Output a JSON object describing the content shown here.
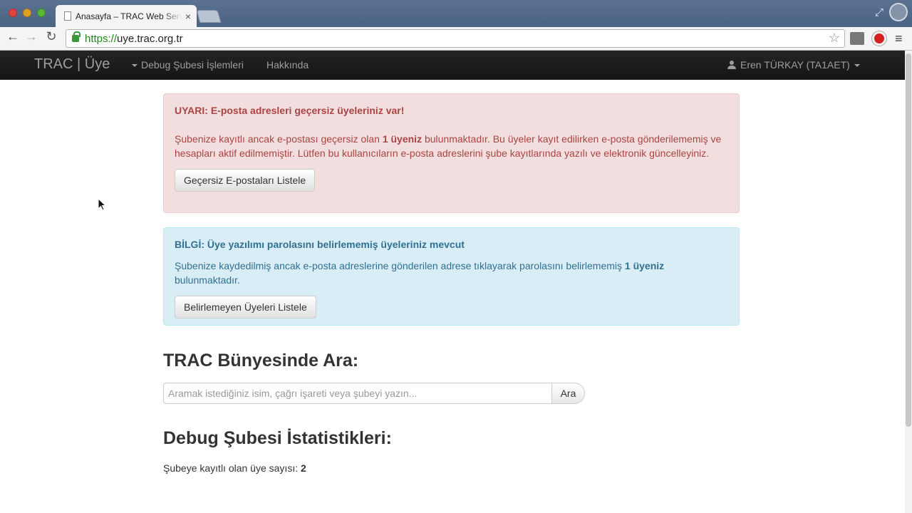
{
  "browser": {
    "tab_title": "Anasayfa – TRAC Web Servisleri",
    "tab_close": "×",
    "url_scheme": "https://",
    "url_rest": "uye.trac.org.tr",
    "icons": {
      "back": "back-arrow-icon",
      "forward": "forward-arrow-icon",
      "reload": "reload-icon",
      "bookmark": "star-icon",
      "menu": "hamburger-menu-icon"
    }
  },
  "navbar": {
    "brand": "TRAC | Üye",
    "debug_menu": "Debug Şubesi İşlemleri",
    "about": "Hakkında",
    "user": "Eren TÜRKAY (TA1AET)"
  },
  "alerts": {
    "danger": {
      "title": "UYARI: E-posta adresleri geçersiz üyeleriniz var!",
      "body_before": "Şubenize kayıtlı ancak e-postası geçersiz olan ",
      "body_bold": "1 üyeniz",
      "body_after": " bulunmaktadır. Bu üyeler kayıt edilirken e-posta gönderilememiş ve hesapları aktif edilmemiştir. Lütfen bu kullanıcıların e-posta adreslerini şube kayıtlarında yazılı ve elektronik güncelleyiniz.",
      "button": "Geçersiz E-postaları Listele",
      "color": "#a94442"
    },
    "info": {
      "title": "BİLGİ: Üye yazılımı parolasını belirlememiş üyeleriniz mevcut",
      "body_before": "Şubenize kaydedilmiş ancak e-posta adreslerine gönderilen adrese tıklayarak parolasını belirlememiş ",
      "body_bold": "1 üyeniz",
      "body_after": " bulunmaktadır.",
      "button": "Belirlemeyen Üyeleri Listele",
      "color": "#31708f"
    }
  },
  "search": {
    "title": "TRAC Bünyesinde Ara:",
    "placeholder": "Aramak istediğiniz isim, çağrı işareti veya şubeyi yazın...",
    "button": "Ara"
  },
  "stats": {
    "title": "Debug Şubesi İstatistikleri:",
    "member_count_label": "Şubeye kayıtlı olan üye sayısı: ",
    "member_count": "2"
  }
}
